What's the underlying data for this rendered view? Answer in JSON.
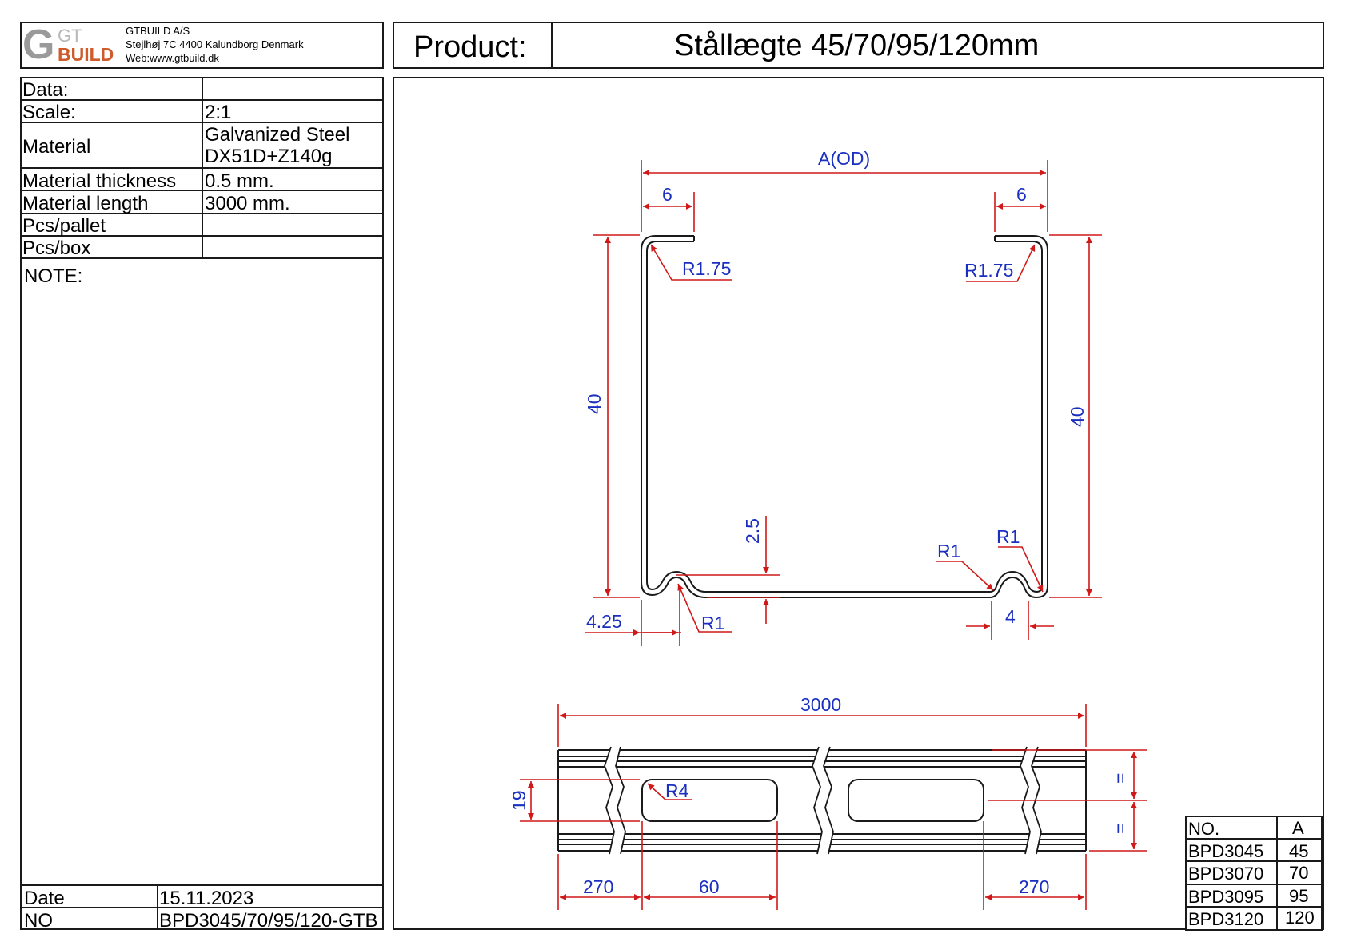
{
  "company": {
    "logo_letter": "G",
    "logo_gt": "GT",
    "logo_build": "BUILD",
    "name": "GTBUILD A/S",
    "address": "Stejlhøj 7C 4400 Kalundborg Denmark",
    "web": "Web:www.gtbuild.dk"
  },
  "product": {
    "label": "Product:",
    "name": "Stållægte 45/70/95/120mm"
  },
  "specs": [
    {
      "key": "Data:",
      "value": ""
    },
    {
      "key": "Scale:",
      "value": "2:1"
    },
    {
      "key": "Material",
      "value": "Galvanized Steel",
      "value2": "DX51D+Z140g"
    },
    {
      "key": "Material thickness",
      "value": "0.5 mm."
    },
    {
      "key": "Material length",
      "value": "3000 mm."
    },
    {
      "key": "Pcs/pallet",
      "value": ""
    },
    {
      "key": "Pcs/box",
      "value": ""
    }
  ],
  "note_label": "NOTE:",
  "footer": {
    "date_label": "Date",
    "date_value": "15.11.2023",
    "no_label": "NO",
    "no_value": "BPD3045/70/95/120-GTB"
  },
  "variants": {
    "headers": [
      "NO.",
      "A"
    ],
    "rows": [
      [
        "BPD3045",
        "45"
      ],
      [
        "BPD3070",
        "70"
      ],
      [
        "BPD3095",
        "95"
      ],
      [
        "BPD3120",
        "120"
      ]
    ]
  },
  "dimensions": {
    "width": "A(OD)",
    "lip_left": "6",
    "lip_right": "6",
    "radius_top_left": "R1.75",
    "radius_top_right": "R1.75",
    "height_left": "40",
    "height_right": "40",
    "groove_depth": "2.5",
    "groove_left_offset": "4.25",
    "groove_left_radius": "R1",
    "groove_right_radius_a": "R1",
    "groove_right_radius_b": "R1",
    "groove_right_width": "4",
    "length_total": "3000",
    "slot_height": "19",
    "slot_radius": "R4",
    "equal_top": "=",
    "equal_bottom": "=",
    "end_offset_left": "270",
    "slot_length": "60",
    "end_offset_right": "270"
  },
  "colors": {
    "outline": "#1a1a1a",
    "dimension": "#d01818",
    "dimension_text": "#1a2fc0"
  }
}
